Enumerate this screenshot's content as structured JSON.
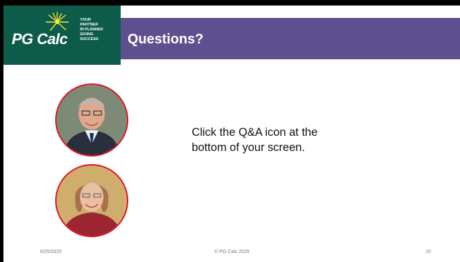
{
  "logo": {
    "name": "PG Calc",
    "tagline": "YOUR\nPARTNER\nIN PLANNED\nGIVING\nSUCCESS"
  },
  "slide": {
    "title": "Questions?",
    "body": "Click the Q&A icon at the\nbottom of your screen."
  },
  "footer": {
    "date": "9/25/2025",
    "copyright": "© PG Calc 2025",
    "page": "10"
  },
  "colors": {
    "logo_bg": "#0d5c4a",
    "title_bar": "#5e4f8f",
    "avatar_border": "#e10f23"
  },
  "icons": [
    "star-burst-icon"
  ]
}
